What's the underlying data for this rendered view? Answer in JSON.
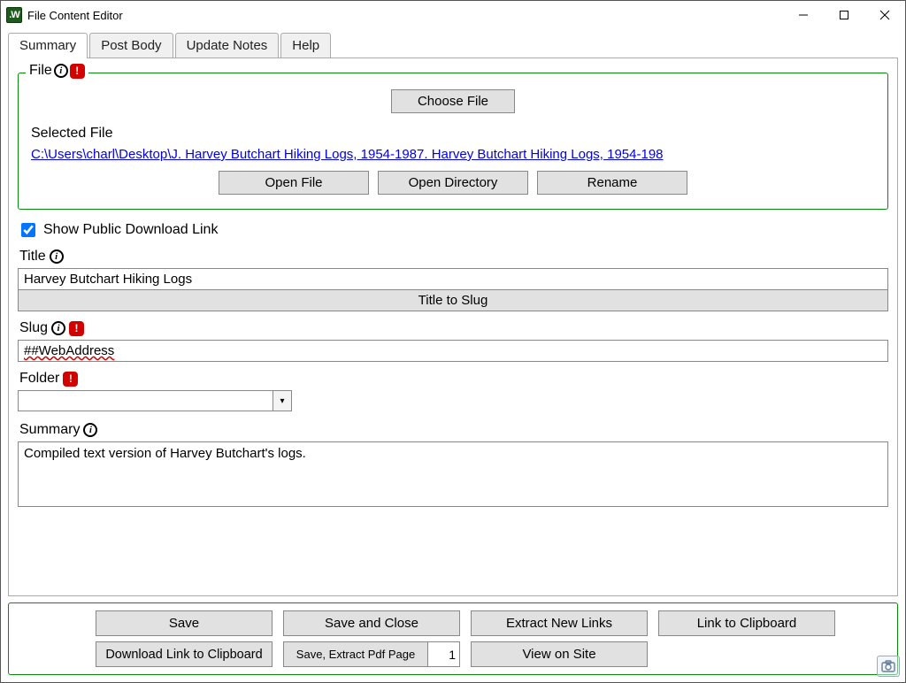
{
  "titlebar": {
    "app_icon_text": ".W",
    "title": "File Content Editor"
  },
  "tabs": {
    "summary": "Summary",
    "post_body": "Post Body",
    "update_notes": "Update Notes",
    "help": "Help"
  },
  "file_group": {
    "legend": "File",
    "choose": "Choose File",
    "selected_label": "Selected File",
    "path": "C:\\Users\\charl\\Desktop\\J. Harvey Butchart Hiking Logs, 1954-1987. Harvey Butchart Hiking Logs, 1954-198",
    "open_file": "Open File",
    "open_directory": "Open Directory",
    "rename": "Rename"
  },
  "show_public": {
    "label": "Show Public Download Link",
    "checked": true
  },
  "title_field": {
    "label": "Title",
    "value": "Harvey Butchart Hiking Logs",
    "to_slug": "Title to Slug"
  },
  "slug_field": {
    "label": "Slug",
    "value": "##WebAddress"
  },
  "folder_field": {
    "label": "Folder",
    "value": ""
  },
  "summary_field": {
    "label": "Summary",
    "value": "Compiled text version of Harvey Butchart's logs."
  },
  "footer": {
    "save": "Save",
    "save_close": "Save and Close",
    "extract_links": "Extract New Links",
    "link_clipboard": "Link to Clipboard",
    "download_link_clipboard": "Download Link to Clipboard",
    "save_extract_pdf": "Save, Extract Pdf Page",
    "pdf_page": "1",
    "view_on_site": "View on Site"
  }
}
